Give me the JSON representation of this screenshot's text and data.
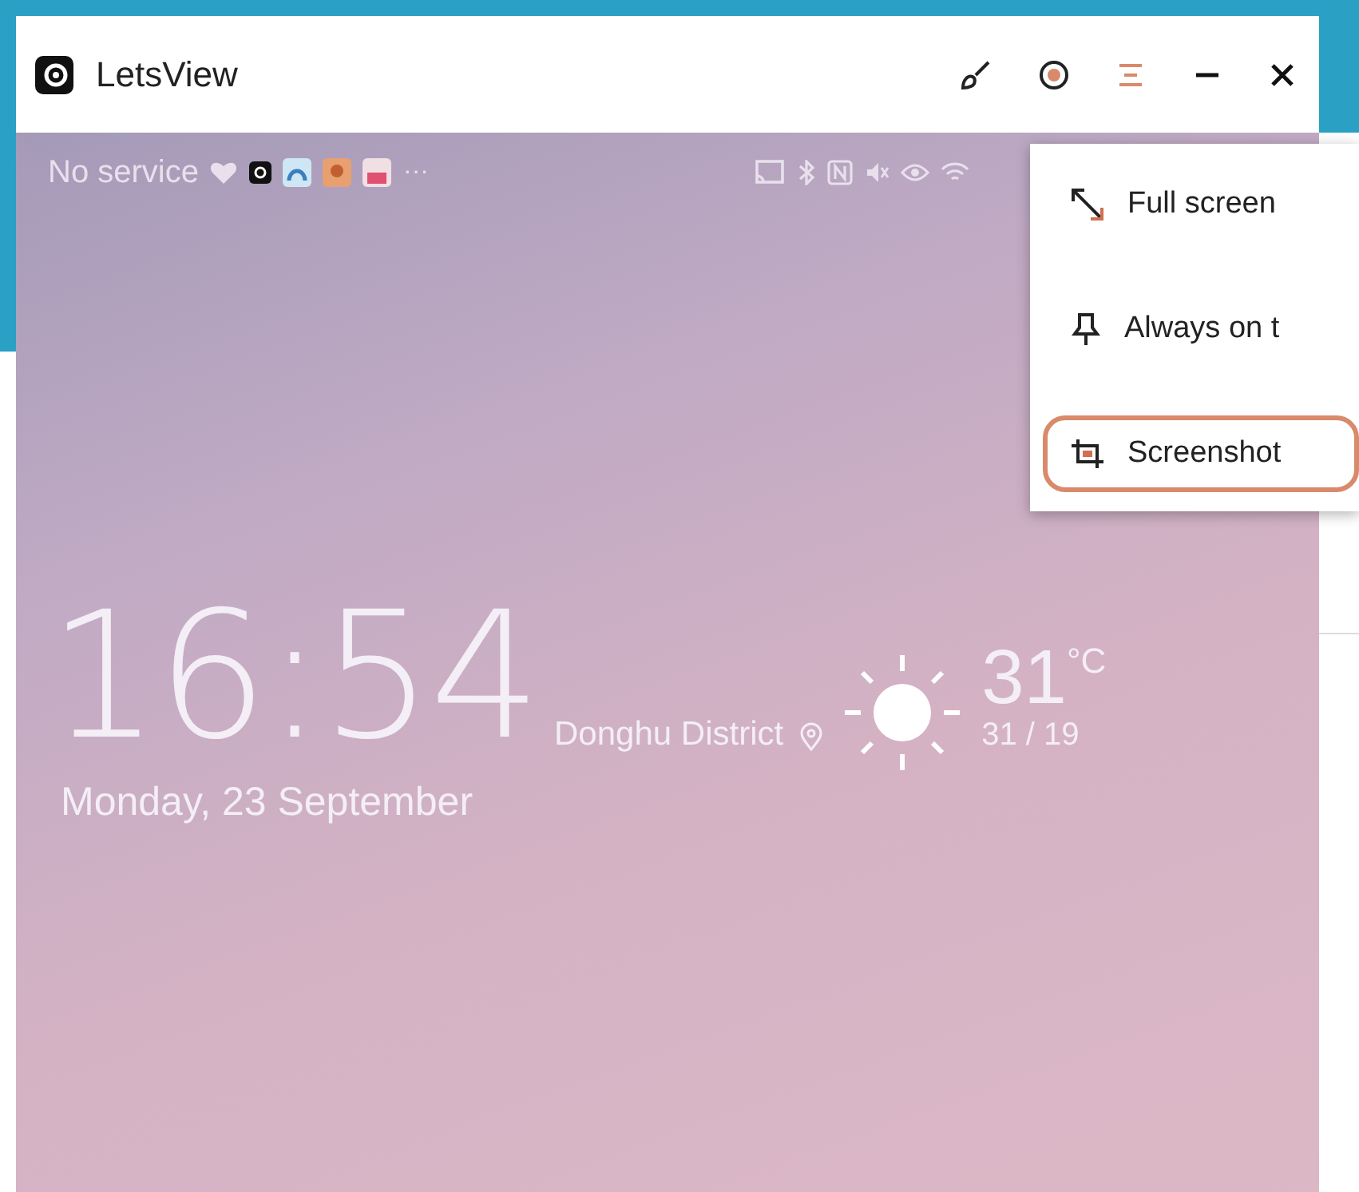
{
  "window": {
    "title": "LetsView"
  },
  "status_bar": {
    "carrier": "No service",
    "more": "···"
  },
  "lock_screen": {
    "time": "16:54",
    "location": "Donghu District",
    "temperature": "31",
    "unit": "°C",
    "range": "31 / 19",
    "date": "Monday, 23 September"
  },
  "menu": {
    "items": [
      {
        "kind": "fullscreen",
        "label": "Full screen",
        "selected": false
      },
      {
        "kind": "pin",
        "label": "Always on t",
        "selected": false
      },
      {
        "kind": "crop",
        "label": "Screenshot",
        "selected": true
      }
    ]
  }
}
